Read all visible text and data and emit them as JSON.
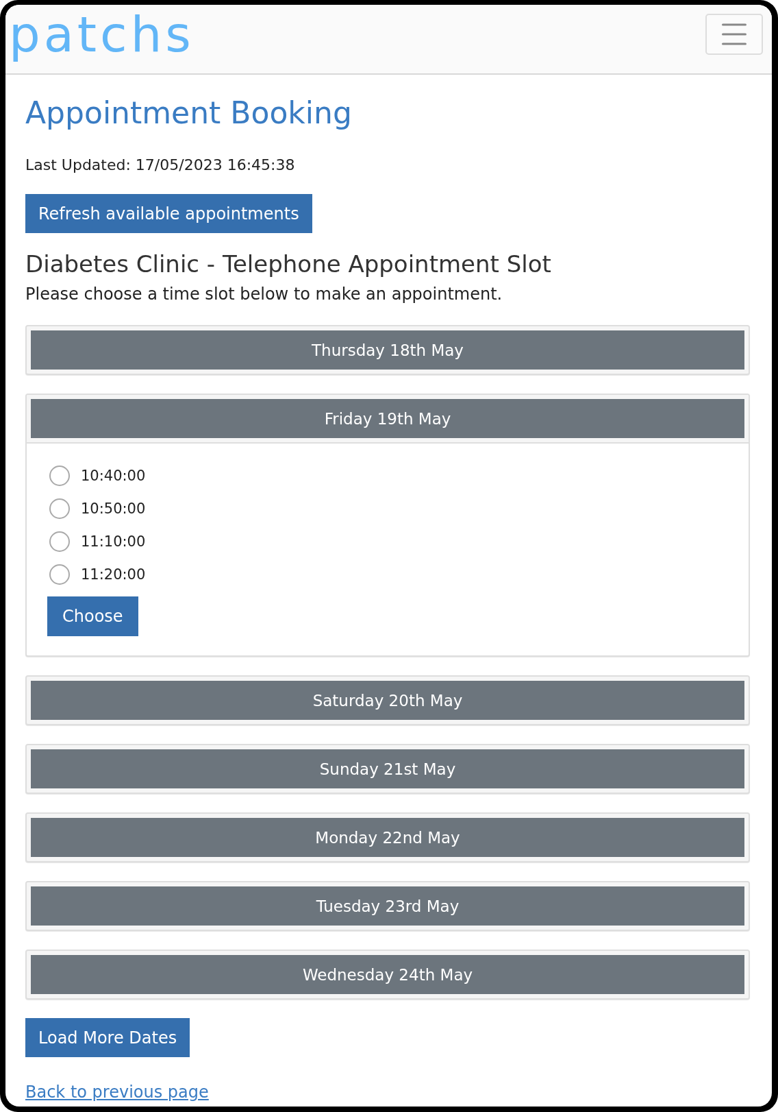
{
  "header": {
    "logo": "patchs"
  },
  "page": {
    "title": "Appointment Booking",
    "last_updated": "Last Updated: 17/05/2023 16:45:38",
    "refresh_button": "Refresh available appointments",
    "clinic_heading": "Diabetes Clinic - Telephone Appointment Slot",
    "instruction": "Please choose a time slot below to make an appointment."
  },
  "days": [
    {
      "label": "Thursday 18th May",
      "expanded": false
    },
    {
      "label": "Friday 19th May",
      "expanded": true,
      "slots": [
        {
          "time": "10:40:00",
          "selected": false
        },
        {
          "time": "10:50:00",
          "selected": false
        },
        {
          "time": "11:10:00",
          "selected": false
        },
        {
          "time": "11:20:00",
          "selected": false
        }
      ],
      "choose_button": "Choose"
    },
    {
      "label": "Saturday 20th May",
      "expanded": false
    },
    {
      "label": "Sunday 21st May",
      "expanded": false
    },
    {
      "label": "Monday 22nd May",
      "expanded": false
    },
    {
      "label": "Tuesday 23rd May",
      "expanded": false
    },
    {
      "label": "Wednesday 24th May",
      "expanded": false
    }
  ],
  "load_more_button": "Load More Dates",
  "back_link": "Back to previous page"
}
